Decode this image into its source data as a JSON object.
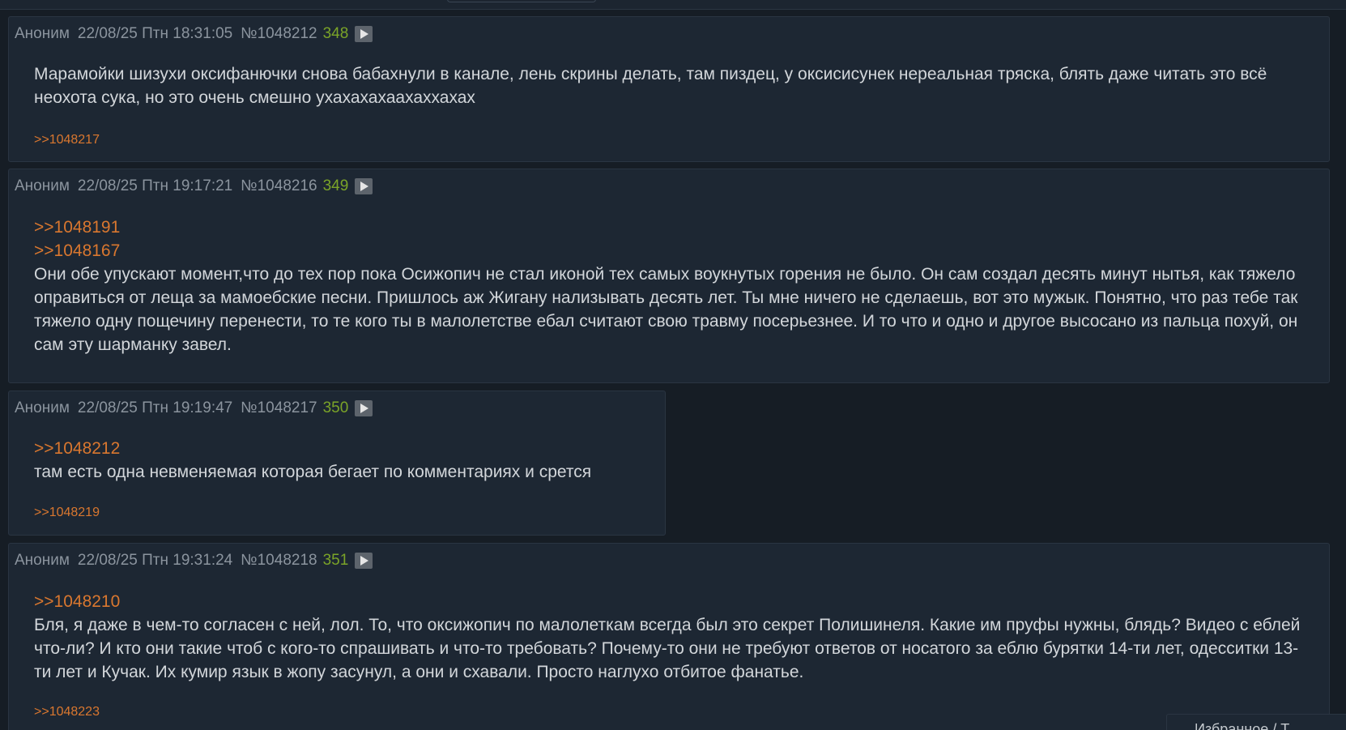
{
  "posts": [
    {
      "author": "Аноним",
      "datetime": "22/08/25 Птн 18:31:05",
      "number": "№1048212",
      "reply_count": "348",
      "reply_to": [],
      "text": "Марамойки шизухи оксифанючки снова бабахнули в канале, лень скрины делать, там пиздец, у оксисисунек нереальная тряска, блять даже читать это всё неохота сука, но это очень смешно ухахахахаахаххахах",
      "backlinks": ">>1048217"
    },
    {
      "author": "Аноним",
      "datetime": "22/08/25 Птн 19:17:21",
      "number": "№1048216",
      "reply_count": "349",
      "reply_to": [
        ">>1048191",
        ">>1048167"
      ],
      "text": "Они обе упускают момент,что до тех пор пока Осижопич не стал иконой тех самых воукнутых горения не было. Он сам создал десять минут нытья, как тяжело оправиться от леща за мамоебские песни. Пришлось аж Жигану нализывать десять лет. Ты мне ничего не сделаешь, вот это мужык. Понятно, что раз тебе так тяжело одну пощечину перенести, то те кого ты в малолетстве ебал считают свою травму посерьезнее. И то что и одно и другое высосано из пальца похуй, он сам эту шарманку завел.",
      "backlinks": ""
    },
    {
      "author": "Аноним",
      "datetime": "22/08/25 Птн 19:19:47",
      "number": "№1048217",
      "reply_count": "350",
      "reply_to": [
        ">>1048212"
      ],
      "text": "там есть одна невменяемая которая бегает по комментариях и срется",
      "backlinks": ">>1048219"
    },
    {
      "author": "Аноним",
      "datetime": "22/08/25 Птн 19:31:24",
      "number": "№1048218",
      "reply_count": "351",
      "reply_to": [
        ">>1048210"
      ],
      "text": "Бля, я даже в чем-то согласен с ней, лол. То, что оксижопич по малолеткам всегда был это секрет Полишинеля. Какие им пруфы нужны, блядь? Видео с еблей что-ли? И кто они такие чтоб с кого-то спрашивать и что-то требовать? Почему-то они не требуют ответов от носатого за еблю бурятки 14-ти лет, одесситки 13-ти лет и Кучак. Их кумир язык в жопу засунул, а они и схавали. Просто наглухо отбитое фанатье.",
      "backlinks": ">>1048223"
    }
  ],
  "corner_panel": {
    "label": "Избранное / Т..."
  },
  "colors": {
    "background": "#161d25",
    "post_background": "#1d2733",
    "link": "#d9772f",
    "reply_count": "#7ba428",
    "meta": "#8b949e",
    "text": "#d2d6da"
  }
}
